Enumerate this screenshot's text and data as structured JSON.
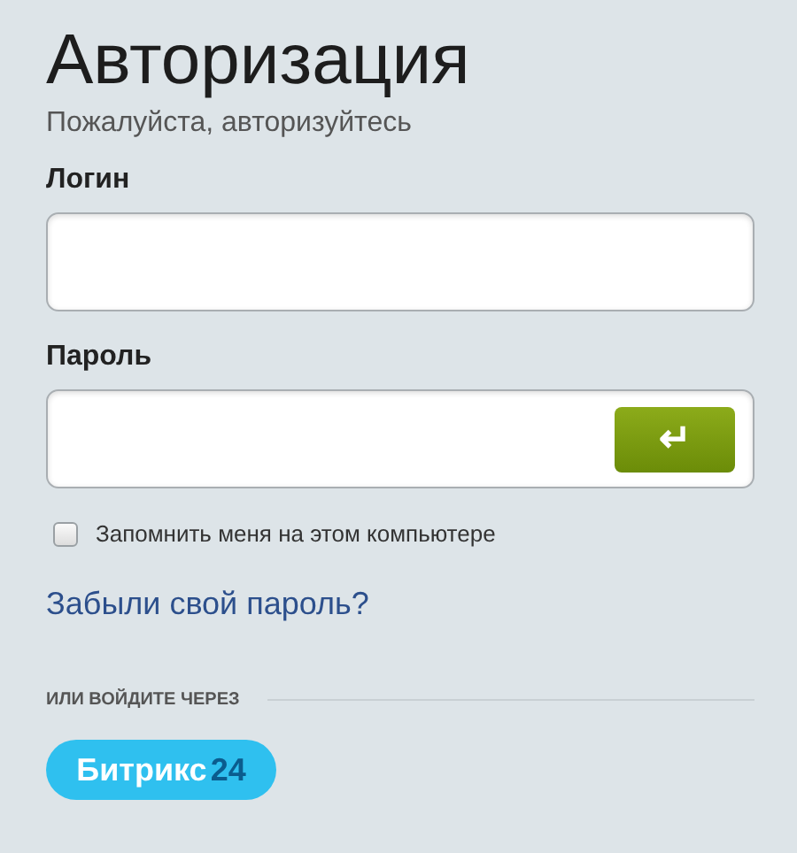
{
  "title": "Авторизация",
  "subtitle": "Пожалуйста, авторизуйтесь",
  "login": {
    "label": "Логин"
  },
  "password": {
    "label": "Пароль",
    "submit_symbol": "↵"
  },
  "remember": {
    "label": "Запомнить меня на этом компьютере",
    "checked": false
  },
  "forgot_link": "Забыли свой пароль?",
  "alt_login": {
    "heading": "ИЛИ ВОЙДИТЕ ЧЕРЕЗ",
    "brand_name": "Битрикс",
    "brand_number": "24"
  }
}
